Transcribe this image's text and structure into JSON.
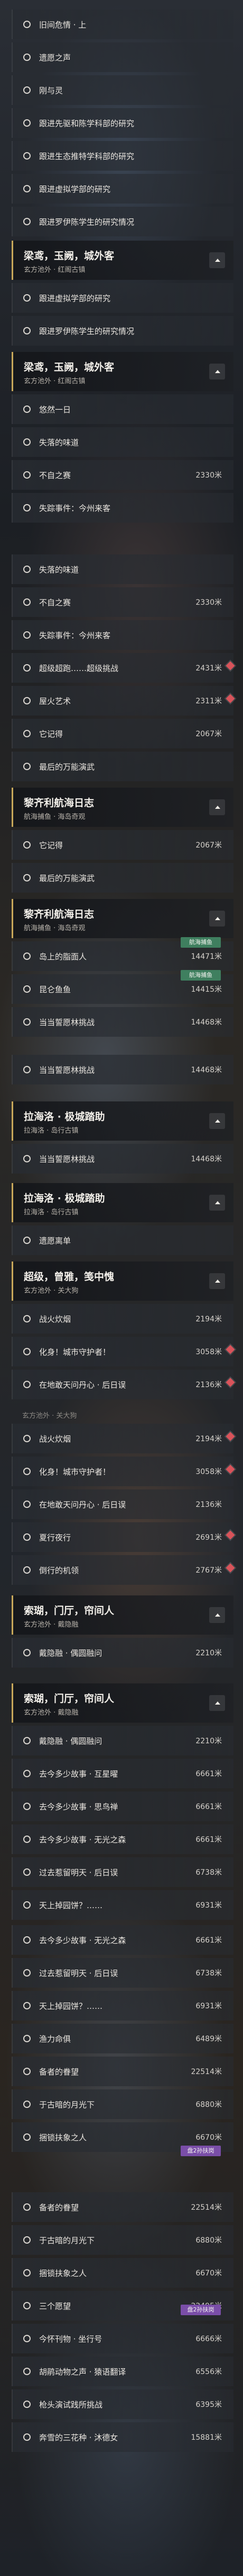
{
  "s1": {
    "rows": [
      {
        "label": "旧间危情 · 上",
        "dist": ""
      },
      {
        "label": "遗愿之声",
        "dist": ""
      },
      {
        "label": "刚与灵",
        "dist": ""
      },
      {
        "label": "跟进先驱和陈学科部的研究",
        "dist": ""
      },
      {
        "label": "跟进生态推特学科部的研究",
        "dist": ""
      },
      {
        "label": "跟进虚拟学部的研究",
        "dist": ""
      },
      {
        "label": "跟进罗伊陈学生的研究情况",
        "dist": ""
      }
    ]
  },
  "g1": {
    "title": "梁鸢，玉阙，城外客",
    "sub": "玄方池外 · 红阁古镇"
  },
  "g1rows": [
    {
      "label": "跟进虚拟学部的研究",
      "dist": ""
    },
    {
      "label": "跟进罗伊陈学生的研究情况",
      "dist": ""
    }
  ],
  "g2": {
    "title": "梁鸢，玉阙，城外客",
    "sub": "玄方池外 · 红阁古镇"
  },
  "g2rows": [
    {
      "label": "悠然一日",
      "dist": ""
    },
    {
      "label": "失落的味道",
      "dist": ""
    },
    {
      "label": "不自之赛",
      "dist": "2330米"
    },
    {
      "label": "失踪事件：今州来客",
      "dist": ""
    }
  ],
  "s3": {
    "rows": [
      {
        "label": "失落的味道",
        "dist": ""
      },
      {
        "label": "不自之赛",
        "dist": "2330米"
      },
      {
        "label": "失踪事件：今州来客",
        "dist": ""
      },
      {
        "label": "超级超跑……超级挑战",
        "dist": "2431米"
      },
      {
        "label": "屋火艺术",
        "dist": "2311米"
      },
      {
        "label": "它记得",
        "dist": "2067米"
      },
      {
        "label": "最后的万能演武",
        "dist": ""
      }
    ]
  },
  "g3": {
    "title": "黎齐利航海日志",
    "sub": "航海捕鱼 · 海岛奇观"
  },
  "g3rows": [
    {
      "label": "它记得",
      "dist": "2067米"
    },
    {
      "label": "最后的万能演武",
      "dist": ""
    }
  ],
  "g4": {
    "title": "黎齐利航海日志",
    "sub": "航海捕鱼 · 海岛奇观"
  },
  "g4rows": [
    {
      "label": "岛上的脂面人",
      "dist": "14471米"
    },
    {
      "label": "昆仑鱼鱼",
      "dist": "14415米"
    },
    {
      "label": "当当誓愿林挑战",
      "dist": "14468米"
    }
  ],
  "badge1": "航海捕鱼",
  "badge2": "航海捕鱼",
  "g4more": [
    {
      "label": "当当誓愿林挑战",
      "dist": "14468米"
    }
  ],
  "g5": {
    "title": "拉海洛 · 极城踏助",
    "sub": "拉海洛 · 岛行古镇"
  },
  "g5rows": [
    {
      "label": "当当誓愿林挑战",
      "dist": "14468米"
    }
  ],
  "g6": {
    "title": "拉海洛 · 极城踏助",
    "sub": "拉海洛 · 岛行古镇"
  },
  "g6rows": [
    {
      "label": "遗愿离单",
      "dist": ""
    }
  ],
  "g7": {
    "title": "超级，曾雅，笺中愧",
    "sub": "玄方池外 · 关大狗"
  },
  "g7rows": [
    {
      "label": "战火炊烟",
      "dist": "2194米"
    },
    {
      "label": "化身！城市守护者！",
      "dist": "3058米"
    },
    {
      "label": "在地敢天问丹心 · 后日误",
      "dist": "2136米"
    }
  ],
  "g7ghost": {
    "sub": "玄方池外 · 关大狗"
  },
  "g7rows2": [
    {
      "label": "战火炊烟",
      "dist": "2194米"
    },
    {
      "label": "化身！城市守护者！",
      "dist": "3058米"
    },
    {
      "label": "在地敢天问丹心 · 后日误",
      "dist": "2136米"
    },
    {
      "label": "夏行夜行",
      "dist": "2691米"
    },
    {
      "label": "倒行的机领",
      "dist": "2767米"
    }
  ],
  "g8": {
    "title": "索瑚，门厅，帘间人",
    "sub": "玄方池外 · 戴隐融"
  },
  "g8rows": [
    {
      "label": "戴隐融 · 偶圆融问",
      "dist": "2210米"
    }
  ],
  "g9": {
    "title": "索瑚，门厅，帘间人",
    "sub": "玄方池外 · 戴隐融"
  },
  "g9rows": [
    {
      "label": "戴隐融 · 偶圆融问",
      "dist": "2210米"
    },
    {
      "label": "去今多少故事 · 互星曜",
      "dist": "6661米"
    },
    {
      "label": "去今多少故事 · 思鸟禅",
      "dist": "6661米"
    },
    {
      "label": "去今多少故事 · 无光之森",
      "dist": "6661米"
    },
    {
      "label": "过去惹留明天 · 后日误",
      "dist": "6738米"
    },
    {
      "label": "天上掉园饼？……",
      "dist": "6931米"
    }
  ],
  "s10": {
    "rows": [
      {
        "label": "去今多少故事 · 无光之森",
        "dist": "6661米"
      },
      {
        "label": "过去惹留明天 · 后日误",
        "dist": "6738米"
      },
      {
        "label": "天上掉园饼？……",
        "dist": "6931米"
      },
      {
        "label": "渔力命俱",
        "dist": "6489米"
      },
      {
        "label": "备者的眷望",
        "dist": "22514米"
      },
      {
        "label": "于古暗的月光下",
        "dist": "6880米"
      },
      {
        "label": "捆锁扶象之人",
        "dist": "6670米"
      }
    ]
  },
  "badge3": "盘2孙扶岗",
  "s11": {
    "rows": [
      {
        "label": "备者的眷望",
        "dist": "22514米"
      },
      {
        "label": "于古暗的月光下",
        "dist": "6880米"
      },
      {
        "label": "捆锁扶象之人",
        "dist": "6670米"
      },
      {
        "label": "三个愿望",
        "dist": "22495米"
      },
      {
        "label": "今怀刊物 · 坐行号",
        "dist": "6666米"
      },
      {
        "label": "胡鹃动物之声 · 猿语翻译",
        "dist": "6556米"
      },
      {
        "label": "枪头演试践所挑战",
        "dist": "6395米"
      },
      {
        "label": "奔雪的三花种 · 沐德女",
        "dist": "15881米"
      }
    ]
  },
  "badge4": "盘2孙扶岗"
}
